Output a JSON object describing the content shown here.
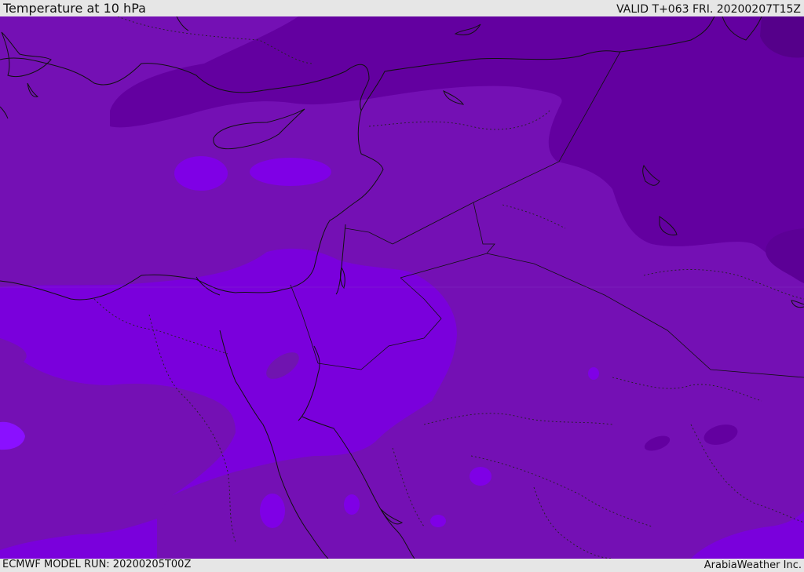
{
  "header": {
    "title": "Temperature at 10 hPa",
    "valid": "VALID T+063 FRI. 20200207T15Z"
  },
  "footer": {
    "model_run": "ECMWF MODEL RUN: 20200205T00Z",
    "credit": "ArabiaWeather Inc."
  },
  "palette": {
    "background_band": "#7a10b8",
    "cold_band": "#6400a0",
    "coldest_band": "#55008c",
    "warm_band": "#7f00e6",
    "warmest_band": "#8a10ff",
    "coastline": "#111111"
  }
}
